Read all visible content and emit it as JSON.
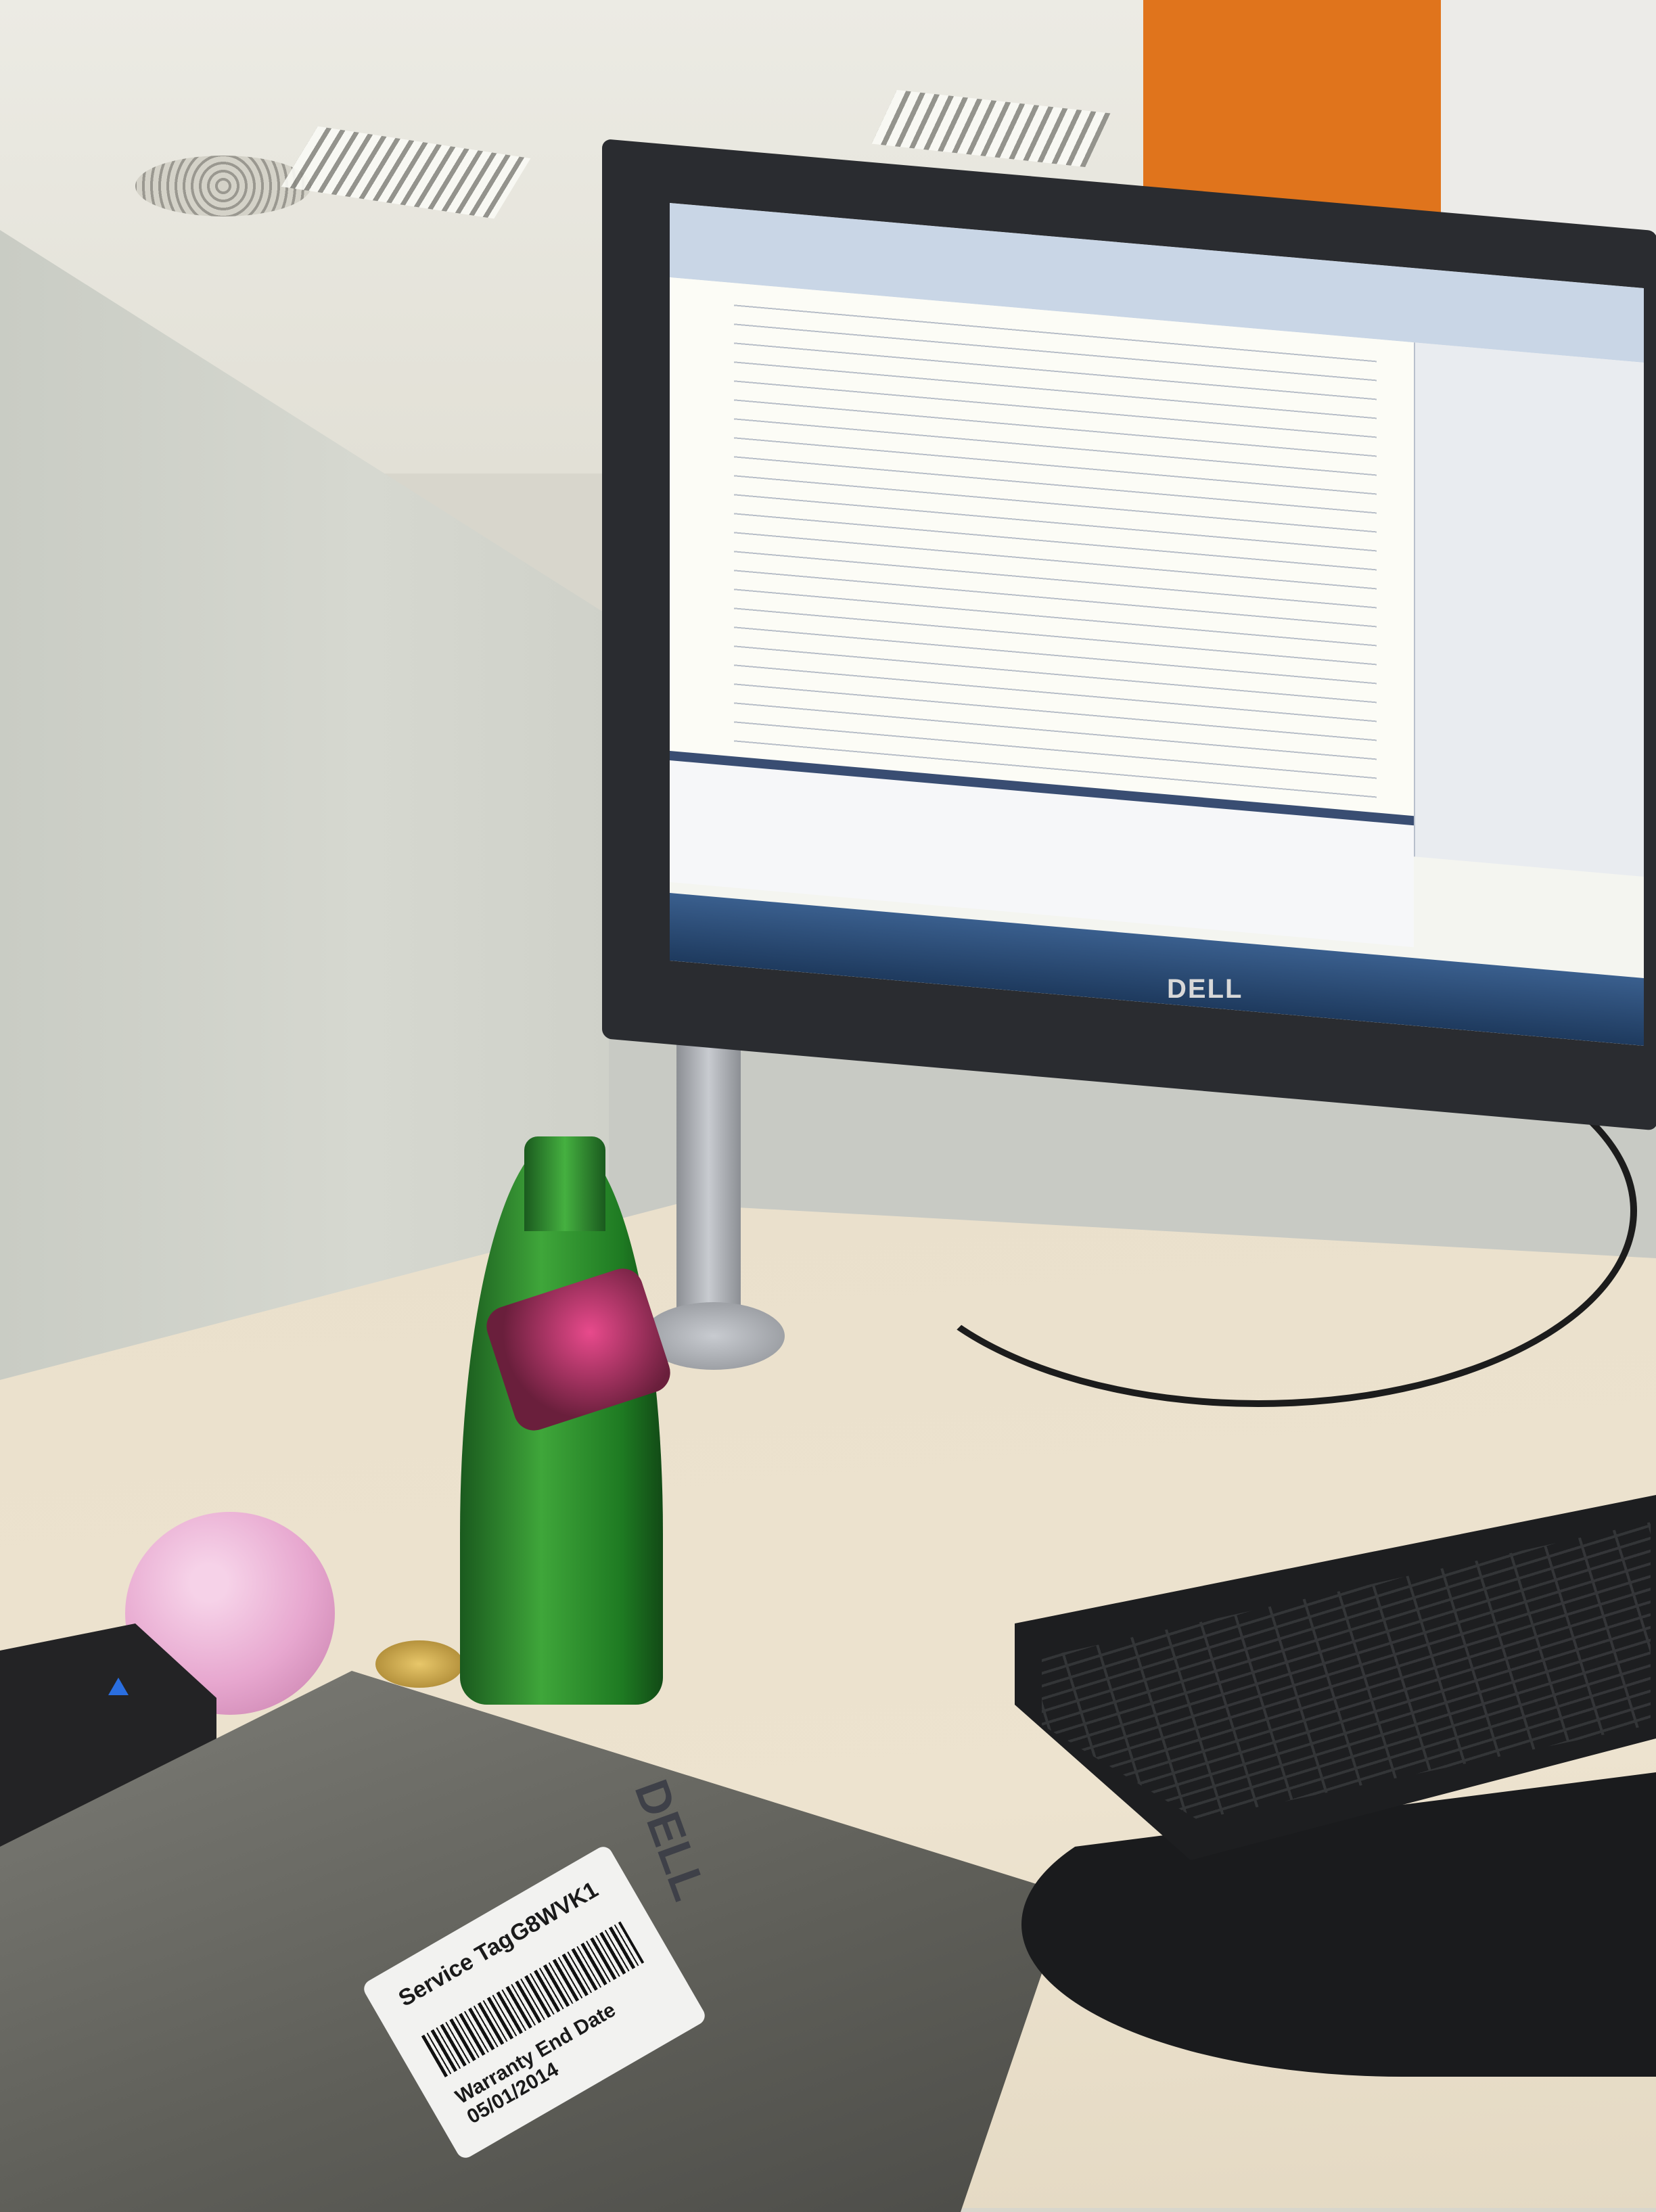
{
  "scene": {
    "monitor_brand": "DELL",
    "laptop_brand": "DELL",
    "service_tag": {
      "label": "Service Tag",
      "code": "G8WVK1",
      "warranty": "Warranty End Date 05/01/2014"
    }
  },
  "colors": {
    "accent_orange": "#e0741c",
    "bottle_green": "#2f8f2f",
    "ball_pink": "#e7a7cf",
    "desk": "#ece2ce"
  }
}
